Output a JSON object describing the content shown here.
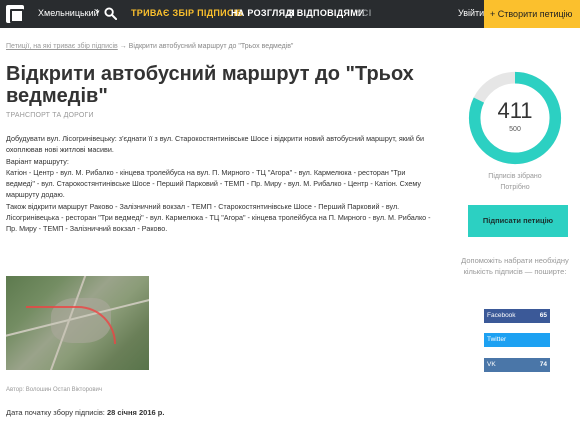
{
  "colors": {
    "topbar": "#292c2f",
    "accent_yellow": "#fbc02d",
    "accent_teal": "#2cd0c2",
    "tab_active_yellow": "#fbc02d",
    "tab_white": "#ffffff",
    "tab_muted": "#8a8d90",
    "facebook": "#3b5998",
    "twitter": "#1da1f2",
    "vk": "#4a76a8"
  },
  "header": {
    "city": "Хмельницький",
    "tabs": [
      {
        "label": "ТРИВАЄ ЗБІР ПІДПИСІВ"
      },
      {
        "label": "НА РОЗГЛЯДІ"
      },
      {
        "label": "З ВІДПОВІДЯМИ"
      },
      {
        "label": "УСІ"
      }
    ],
    "login": "Увійти",
    "create": "+ Створити петицію"
  },
  "breadcrumb": {
    "link": "Петиції, на які триває збір підписів",
    "separator": "→",
    "current": "Відкрити автобусний маршрут до \"Трьох ведмедів\""
  },
  "petition": {
    "title": "Відкрити автобусний маршрут до \"Трьох ведмедів\"",
    "category": "ТРАНСПОРТ ТА ДОРОГИ",
    "paragraphs": [
      "Добудувати вул. Лісогринівецьку: з'єднати її з вул. Старокостянтинівське Шосе і відкрити новий автобусний маршрут, який би охоплював нові житлові масиви.",
      "Варіант маршруту:",
      "Катіон - Центр - вул. М. Рибалко - кінцева тролейбуса на вул. П. Мирного - ТЦ \"Агора\" - вул. Кармелюка - ресторан \"Три ведмеді\" - вул. Старокостянтинівське Шосе - Перший Парковий - ТЕМП - Пр. Миру - вул. М. Рибалко - Центр - Катіон. Схему маршруту додаю.",
      "Також відкрити маршрут Раково - Залізничний вокзал - ТЕМП - Старокостянтинівське Шосе - Перший Парковий - вул. Лісогринівецька - ресторан \"Три ведмеді\" - вул. Кармелюка - ТЦ \"Агора\" - кінцева тролейбуса на П. Мирного - вул. М. Рибалко - Пр. Миру - ТЕМП - Залізничний вокзал - Раково."
    ],
    "author": "Автор: Волошин Остап Вікторович",
    "start_date_label": "Дата початку збору підписів:",
    "start_date": "28 січня 2016 р."
  },
  "signatures": {
    "count": "411",
    "needed": "500",
    "progress_fraction": 0.822,
    "collected_label": "Підписів зібрано",
    "needed_label": "Потрібно"
  },
  "sign_button": "Підписати петицію",
  "share": {
    "text": "Допоможіть набрати необхідну кількість підписів — поширте:",
    "facebook": {
      "label": "Facebook",
      "count": "65"
    },
    "twitter": {
      "label": "Twitter",
      "count": ""
    },
    "vk": {
      "label": "VK",
      "count": "74"
    }
  }
}
